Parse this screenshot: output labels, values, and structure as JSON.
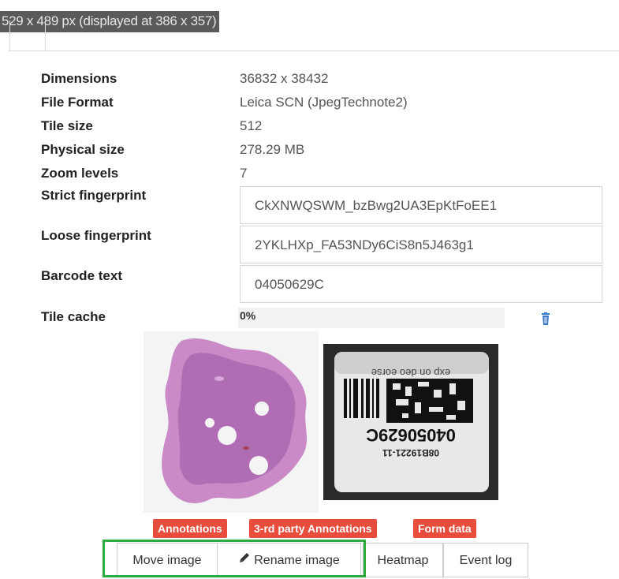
{
  "header": {
    "size_text": "529 x 489 px (displayed at 386 x 357)"
  },
  "properties": [
    {
      "label": "Dimensions",
      "value": "36832 x 38432"
    },
    {
      "label": "File Format",
      "value": "Leica SCN (JpegTechnote2)"
    },
    {
      "label": "Tile size",
      "value": "512"
    },
    {
      "label": "Physical size",
      "value": "278.29 MB"
    },
    {
      "label": "Zoom levels",
      "value": "7"
    }
  ],
  "fields": {
    "strict_fingerprint": {
      "label": "Strict fingerprint",
      "value": "CkXNWQSWM_bzBwg2UA3EpKtFoEE1"
    },
    "loose_fingerprint": {
      "label": "Loose fingerprint",
      "value": "2YKLHXp_FA53NDy6CiS8n5J463g1"
    },
    "barcode_text": {
      "label": "Barcode text",
      "value": "04050629C"
    }
  },
  "tile_cache": {
    "label": "Tile cache",
    "value": "0%",
    "progress": 0
  },
  "label_image": {
    "line_top": "exp on deo eorse",
    "line_id": "08B19221-11",
    "line_code": "04050629C"
  },
  "tags": {
    "annotations": "Annotations",
    "third_party": "3-rd party Annotations",
    "form_data": "Form data"
  },
  "actions": {
    "move_image": "Move image",
    "rename_image": "Rename image",
    "heatmap": "Heatmap",
    "event_log": "Event log"
  },
  "colors": {
    "tag_red": "#e74c3c",
    "highlight_green": "#2eaa3f"
  }
}
